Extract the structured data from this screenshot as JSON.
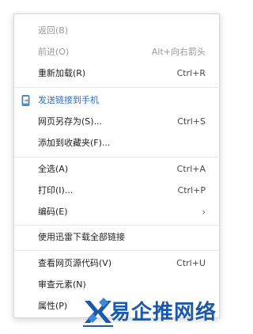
{
  "menu": {
    "items": [
      {
        "label": "返回(B)",
        "shortcut": "",
        "disabled": true
      },
      {
        "label": "前进(O)",
        "shortcut": "Alt+向右箭头",
        "disabled": true
      },
      {
        "label": "重新加载(R)",
        "shortcut": "Ctrl+R",
        "disabled": false
      },
      {
        "label": "发送链接到手机",
        "shortcut": "",
        "icon": "send-to-phone-icon"
      },
      {
        "label": "网页另存为(S)...",
        "shortcut": "Ctrl+S"
      },
      {
        "label": "添加到收藏夹(F)...",
        "shortcut": ""
      },
      {
        "label": "全选(A)",
        "shortcut": "Ctrl+A"
      },
      {
        "label": "打印(I)...",
        "shortcut": "Ctrl+P"
      },
      {
        "label": "编码(E)",
        "shortcut": "",
        "submenu": true
      },
      {
        "label": "使用迅雷下载全部链接",
        "shortcut": ""
      },
      {
        "label": "查看网页源代码(V)",
        "shortcut": "Ctrl+U"
      },
      {
        "label": "审查元素(N)",
        "shortcut": ""
      },
      {
        "label": "属性(P)",
        "shortcut": ""
      }
    ],
    "submenu_arrow": "›"
  },
  "watermark": {
    "text": "易企推网络",
    "color": "#1b5aa8"
  },
  "colors": {
    "highlight": "#2d6fc4",
    "disabled": "#9a9a9a"
  }
}
